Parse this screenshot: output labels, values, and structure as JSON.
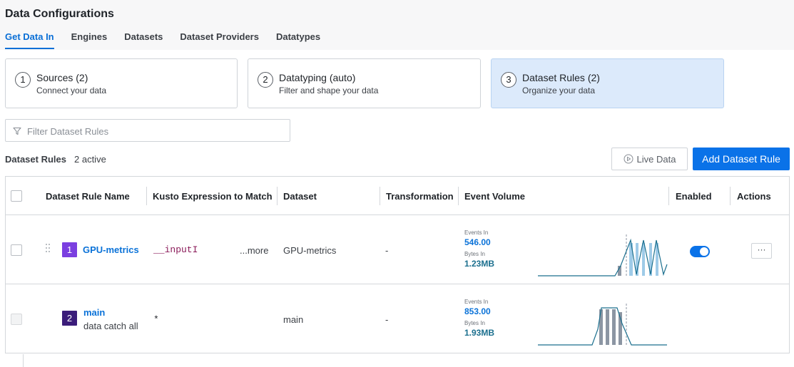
{
  "page": {
    "title": "Data Configurations"
  },
  "tabs": [
    "Get Data In",
    "Engines",
    "Datasets",
    "Dataset Providers",
    "Datatypes"
  ],
  "active_tab": "Get Data In",
  "steps": [
    {
      "num": "1",
      "title": "Sources (2)",
      "subtitle": "Connect your data"
    },
    {
      "num": "2",
      "title": "Datatyping (auto)",
      "subtitle": "Filter and shape your data"
    },
    {
      "num": "3",
      "title": "Dataset Rules (2)",
      "subtitle": "Organize your data"
    }
  ],
  "active_step": 3,
  "filter": {
    "placeholder": "Filter Dataset Rules",
    "value": ""
  },
  "toolbar": {
    "label": "Dataset Rules",
    "count": "2 active",
    "live_data": "Live Data",
    "add_rule": "Add Dataset Rule"
  },
  "columns": [
    "Dataset Rule Name",
    "Kusto Expression to Match",
    "Dataset",
    "Transformation",
    "Event Volume",
    "Enabled",
    "Actions"
  ],
  "rows": [
    {
      "index": "1",
      "index_color": "#7b3fe0",
      "name": "GPU-metrics",
      "description": "",
      "expression": "__inputI",
      "expression_more": "...more",
      "dataset": "GPU-metrics",
      "transformation": "-",
      "events_label": "Events In",
      "events": "546.00",
      "bytes_label": "Bytes In",
      "bytes": "1.23MB",
      "enabled": true,
      "actions_label": "···"
    },
    {
      "index": "2",
      "index_color": "#3b1d7a",
      "name": "main",
      "description": "data catch all",
      "expression": "*",
      "expression_more": "",
      "dataset": "main",
      "transformation": "-",
      "events_label": "Events In",
      "events": "853.00",
      "bytes_label": "Bytes In",
      "bytes": "1.93MB",
      "enabled": false,
      "actions_label": ""
    }
  ],
  "colors": {
    "accent": "#0a72e8",
    "link": "#0a72d8",
    "sparkline_line": "#1b6f8e",
    "sparkline_bar_light": "#9fcbe8",
    "sparkline_bar_gray": "#8c96a3"
  }
}
